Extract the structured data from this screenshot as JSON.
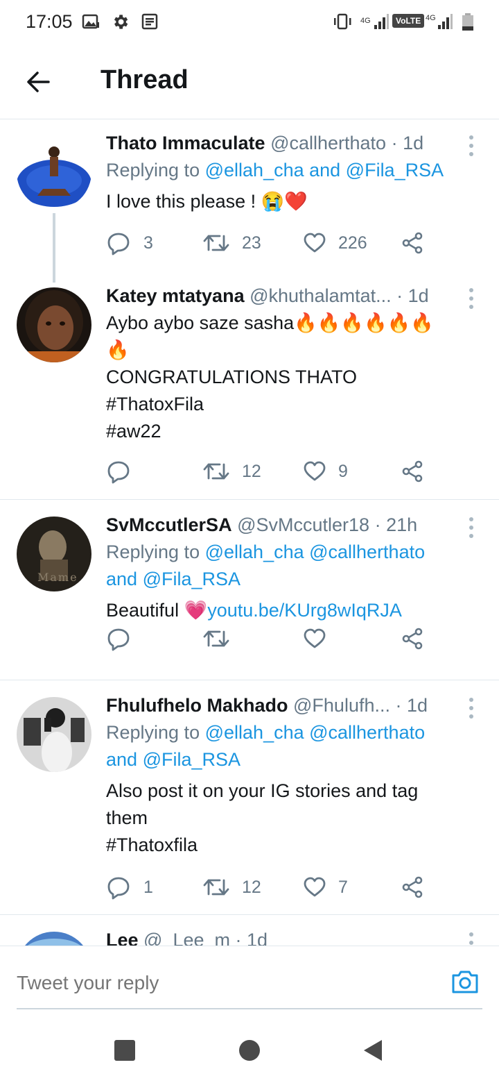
{
  "status_bar": {
    "time": "17:05",
    "network_1": "4G",
    "volte": "VoLTE",
    "network_2": "4G"
  },
  "header": {
    "title": "Thread"
  },
  "tweets": [
    {
      "name": "Thato Immaculate",
      "handle": "@callherthato",
      "time": "· 1d",
      "replying_prefix": "Replying to",
      "replying_mentions": "@ellah_cha and @Fila_RSA",
      "text": "I love this please !",
      "emoji": "😭❤️",
      "replies": "3",
      "retweets": "23",
      "likes": "226"
    },
    {
      "name": "Katey mtatyana",
      "handle": "@khuthalamtat...",
      "time": "· 1d",
      "text_line1": "Aybo aybo saze sasha",
      "fire_row1": "🔥🔥🔥🔥🔥🔥",
      "fire_row2": "🔥",
      "text_line3": "CONGRATULATIONS THATO",
      "hashtag1": "#ThatoxFila",
      "hashtag2": "#aw22",
      "replies": "",
      "retweets": "12",
      "likes": "9"
    },
    {
      "name": "SvMccutlerSA",
      "handle": "@SvMccutler18",
      "time": "· 21h",
      "replying_prefix": "Replying to",
      "replying_line1": "@ellah_cha @callherthato",
      "replying_line2_and": "and",
      "replying_line2": "@Fila_RSA",
      "text": "Beautiful",
      "emoji": "💗",
      "link": "youtu.be/KUrg8wIqRJA",
      "avatar_text": "Mame"
    },
    {
      "name": "Fhulufhelo Makhado",
      "handle": "@Fhulufh...",
      "time": "· 1d",
      "replying_prefix": "Replying to",
      "replying_line1": "@ellah_cha @callherthato",
      "replying_line2_and": "and",
      "replying_line2": "@Fila_RSA",
      "text_line1": "Also post it on your IG stories and tag",
      "text_line2": "them",
      "hashtag": "#Thatoxfila",
      "replies": "1",
      "retweets": "12",
      "likes": "7"
    },
    {
      "name": "Lee",
      "handle": "@_Lee_m",
      "time": "· 1d"
    }
  ],
  "composer": {
    "placeholder": "Tweet your reply"
  },
  "colors": {
    "link": "#1b95e0",
    "secondary_text": "#657786",
    "primary_text": "#14171a",
    "divider": "#e1e8ed"
  }
}
